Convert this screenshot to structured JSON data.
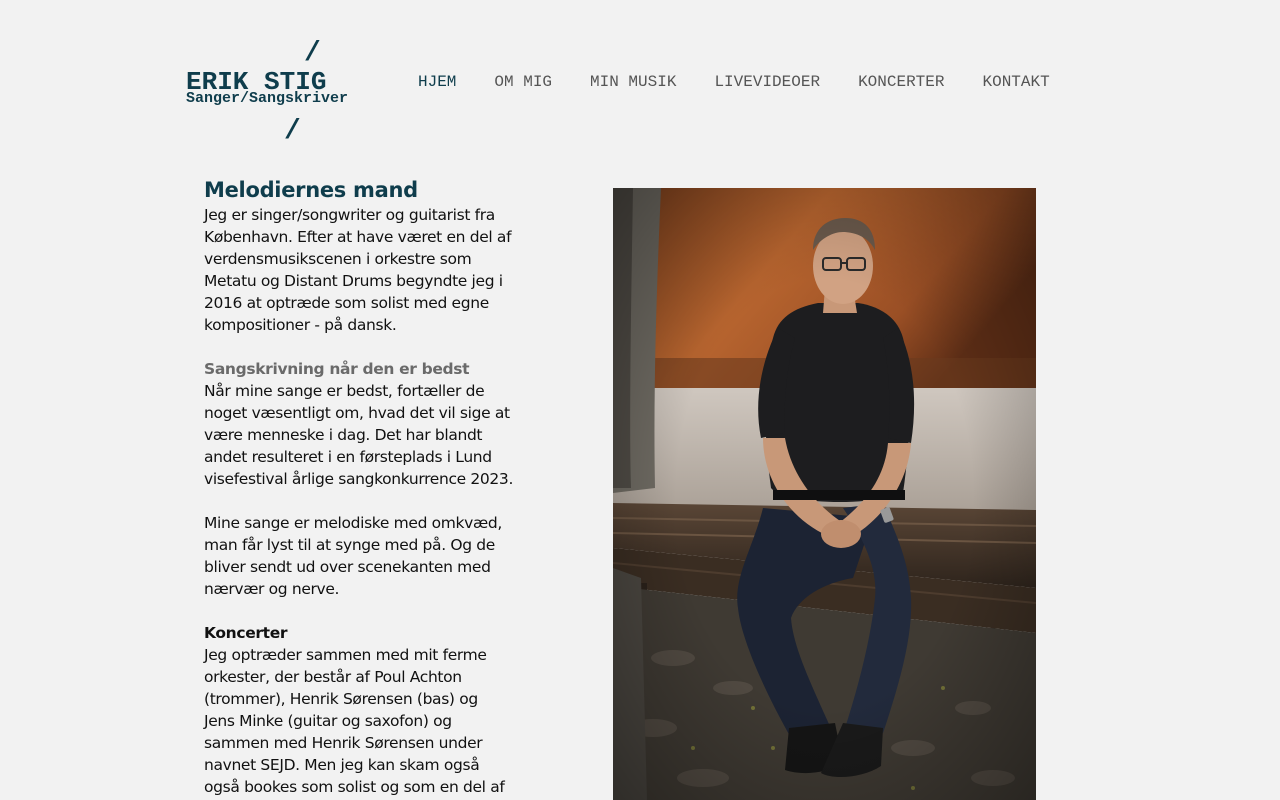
{
  "logo": {
    "slash_top": "/",
    "name": "ERIK STIG",
    "subtitle": "Sanger/Sangskriver",
    "slash_bottom": "/"
  },
  "nav": {
    "items": [
      {
        "label": "HJEM"
      },
      {
        "label": "OM MIG"
      },
      {
        "label": "MIN MUSIK"
      },
      {
        "label": "LIVEVIDEOER"
      },
      {
        "label": "KONCERTER"
      },
      {
        "label": "KONTAKT"
      }
    ]
  },
  "content": {
    "headline": "Melodiernes mand",
    "lines": {
      "p1": [
        "Jeg er singer/songwriter og guitarist fra",
        "København. Efter at have været en del af",
        "verdensmusikscenen i orkestre som",
        "Metatu og Distant Drums begyndte jeg i",
        "2016 at optræde som solist med egne",
        "kompositioner - på dansk."
      ],
      "subhead1": "Sangskrivning når den er bedst",
      "p2": [
        "Når mine sange er bedst, fortæller de",
        "noget væsentligt om, hvad det vil sige at",
        "være menneske i dag. Det har blandt",
        "andet resulteret i en førsteplads i Lund",
        "visefestival årlige sangkonkurrence 2023."
      ],
      "p3": [
        "Mine sange er melodiske med omkvæd,",
        "man får lyst til at synge med på. Og de",
        "bliver sendt ud over scenekanten med",
        "nærvær og nerve."
      ],
      "subhead2": "Koncerter",
      "p4": [
        "Jeg optræder sammen med mit ferme",
        "orkester, der består af Poul Achton",
        "(trommer), Henrik Sørensen (bas) og",
        "Jens Minke (guitar og saxofon) og",
        "sammen med Henrik Sørensen under",
        "navnet SEJD. Men jeg kan skam også",
        "også bookes som solist og som en del af"
      ]
    }
  },
  "colors": {
    "brand": "#0f3d4c",
    "background": "#f2f2f2",
    "nav_text": "#555555",
    "subhead_grey": "#6a6a6a"
  }
}
